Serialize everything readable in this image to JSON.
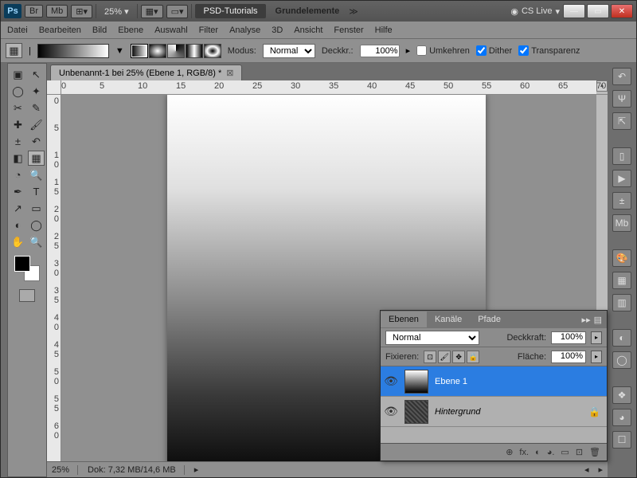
{
  "titlebar": {
    "logo": "Ps",
    "br": "Br",
    "mb": "Mb",
    "zoom": "25%",
    "workspace1": "PSD-Tutorials",
    "workspace2": "Grundelemente",
    "cs": "CS Live"
  },
  "menu": {
    "file": "Datei",
    "edit": "Bearbeiten",
    "image": "Bild",
    "layer": "Ebene",
    "select": "Auswahl",
    "filter": "Filter",
    "analysis": "Analyse",
    "threeD": "3D",
    "view": "Ansicht",
    "window": "Fenster",
    "help": "Hilfe"
  },
  "options": {
    "modeLabel": "Modus:",
    "mode": "Normal",
    "opacityLabel": "Deckkr.:",
    "opacity": "100%",
    "reverse": "Umkehren",
    "dither": "Dither",
    "transparency": "Transparenz"
  },
  "document": {
    "tab": "Unbenannt-1 bei 25% (Ebene 1, RGB/8) *"
  },
  "ruler": [
    "0",
    "5",
    "10",
    "15",
    "20",
    "25",
    "30",
    "35",
    "40",
    "45",
    "50",
    "55",
    "60",
    "65",
    "70"
  ],
  "rulerV": [
    "0",
    "5",
    "1\n0",
    "1\n5",
    "2\n0",
    "2\n5",
    "3\n0",
    "3\n5",
    "4\n0",
    "4\n5",
    "5\n0",
    "5\n5",
    "6\n0"
  ],
  "status": {
    "zoom": "25%",
    "doc": "Dok: 7,32 MB/14,6 MB"
  },
  "layers": {
    "tabs": {
      "layers": "Ebenen",
      "channels": "Kanäle",
      "paths": "Pfade"
    },
    "blend": "Normal",
    "opacityLabel": "Deckkraft:",
    "opacity": "100%",
    "lockLabel": "Fixieren:",
    "fillLabel": "Fläche:",
    "fill": "100%",
    "items": [
      {
        "name": "Ebene 1"
      },
      {
        "name": "Hintergrund"
      }
    ],
    "footer": [
      "⊕",
      "fx.",
      "◐",
      "◕.",
      "▭",
      "⊡",
      "🗑"
    ]
  }
}
